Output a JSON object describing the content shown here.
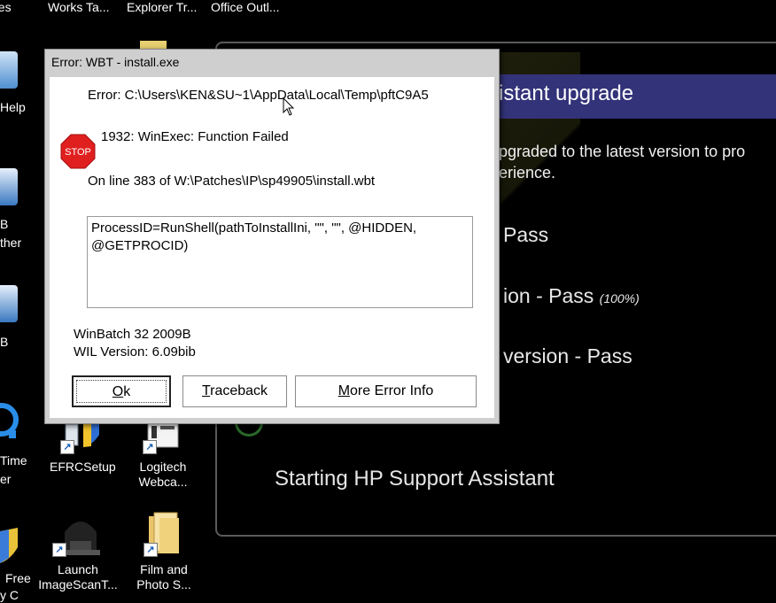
{
  "desktop": {
    "taskbar_labels": [
      "nes",
      "Works Ta...",
      "Explorer Tr...",
      "Office Outl..."
    ],
    "left_fragments": [
      "Help",
      "B",
      "ther",
      "B",
      "Time",
      "er",
      "Free",
      "y C"
    ],
    "icons": [
      {
        "line1": "EFRCSetup",
        "line2": ""
      },
      {
        "line1": "Logitech",
        "line2": "Webca..."
      },
      {
        "line1": "Launch",
        "line2": "ImageScanT..."
      },
      {
        "line1": "Film and",
        "line2": "Photo S..."
      }
    ]
  },
  "hp_window": {
    "title": "sistant upgrade",
    "description_line1": "upgraded to the latest version to pro",
    "description_line2": "perience.",
    "step1": "Pass",
    "step2": "ion - Pass",
    "step2_pct": "(100%)",
    "step3": "version - Pass",
    "starting": "Starting HP Support Assistant"
  },
  "dialog": {
    "title": "Error:  WBT - install.exe",
    "error_path": "Error:  C:\\Users\\KEN&SU~1\\AppData\\Local\\Temp\\pftC9A5",
    "error_code": "1932:  WinExec: Function Failed",
    "stop_label": "STOP",
    "line_info": "On line 383 of W:\\Patches\\IP\\sp49905\\install.wbt",
    "code_line1": "ProcessID=RunShell(pathToInstallIni, \"\", \"\", @HIDDEN,",
    "code_line2": "@GETPROCID)",
    "product": "WinBatch 32 2009B",
    "wil_version": "WIL Version: 6.09bib",
    "buttons": {
      "ok_key": "O",
      "ok_rest": "k",
      "traceback_key": "T",
      "traceback_rest": "raceback",
      "more_key": "M",
      "more_rest": "ore Error Info"
    }
  },
  "colors": {
    "desktop_bg": "#000000",
    "hp_title_bar": "#33337a",
    "dialog_face": "#cfcfcf",
    "stop_red": "#e01f1f"
  }
}
